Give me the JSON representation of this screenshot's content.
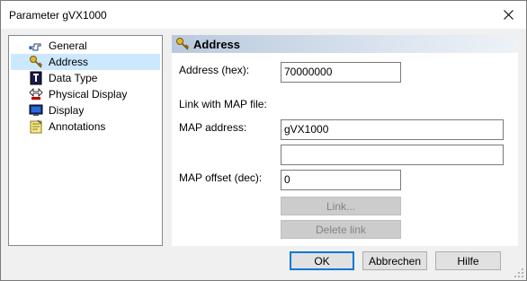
{
  "window": {
    "title": "Parameter gVX1000"
  },
  "tree": {
    "items": [
      {
        "label": "General",
        "icon": "hand-pointer-icon",
        "selected": false
      },
      {
        "label": "Address",
        "icon": "key-icon",
        "selected": true
      },
      {
        "label": "Data Type",
        "icon": "data-type-icon",
        "selected": false
      },
      {
        "label": "Physical Display",
        "icon": "arrows-icon",
        "selected": false
      },
      {
        "label": "Display",
        "icon": "monitor-icon",
        "selected": false
      },
      {
        "label": "Annotations",
        "icon": "notes-icon",
        "selected": false
      }
    ]
  },
  "panel": {
    "title": "Address",
    "address_label": "Address (hex):",
    "address_value": "70000000",
    "link_label": "Link with MAP file:",
    "map_address_label": "MAP address:",
    "map_address_value": "gVX1000",
    "map_address_extra_value": "",
    "map_offset_label": "MAP offset (dec):",
    "map_offset_value": "0",
    "link_button": "Link...",
    "delete_link_button": "Delete link"
  },
  "footer": {
    "ok": "OK",
    "cancel": "Abbrechen",
    "help": "Hilfe"
  },
  "colors": {
    "selection": "#cce8ff",
    "accent": "#0078d7",
    "header_gradient": "#b9c9dd"
  }
}
